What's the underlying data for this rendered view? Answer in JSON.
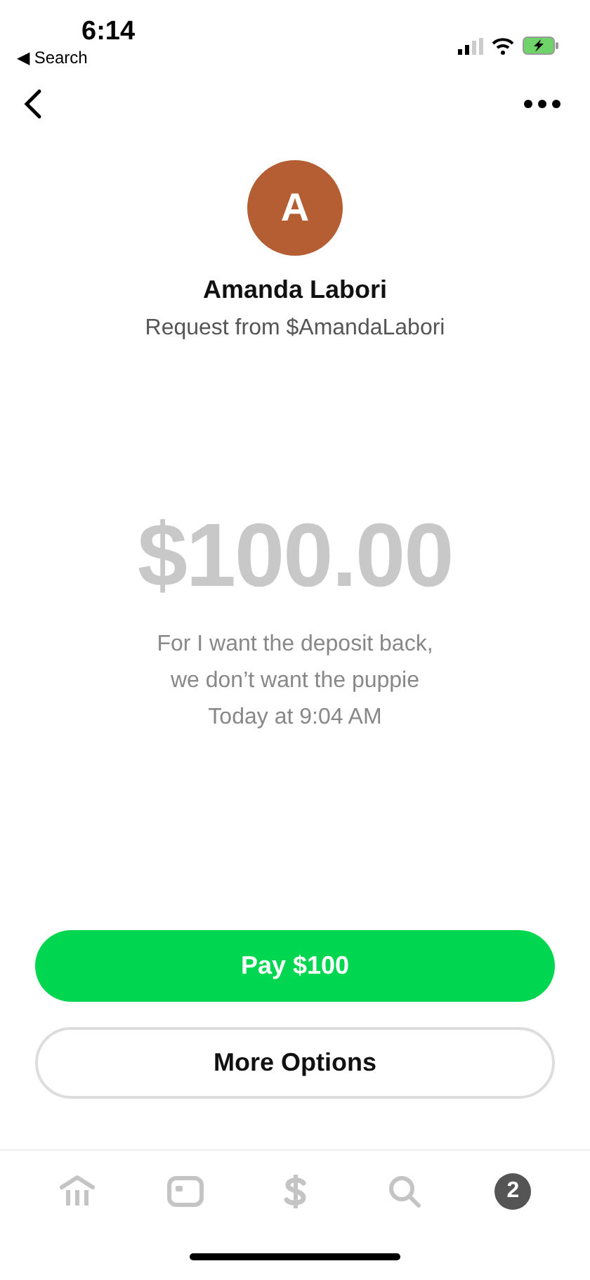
{
  "status_bar": {
    "time": "6:14",
    "back_label": "◀ Search"
  },
  "profile": {
    "initial": "A",
    "color": "#b55e34",
    "name": "Amanda Labori",
    "subtitle": "Request from $AmandaLabori"
  },
  "amount": "$100.00",
  "note_lines": [
    "For I want the deposit back,",
    "we don’t want the puppie",
    "Today at 9:04 AM"
  ],
  "buttons": [
    {
      "label": "Pay $100",
      "kind": "primary"
    },
    {
      "label": "More Options",
      "kind": "secondary"
    }
  ],
  "tabs": [
    {
      "kind": "bank",
      "selected": false
    },
    {
      "kind": "card",
      "selected": false
    },
    {
      "kind": "dollar",
      "selected": false
    },
    {
      "kind": "search",
      "selected": false
    },
    {
      "kind": "activity",
      "badge": "2",
      "selected": false
    }
  ]
}
